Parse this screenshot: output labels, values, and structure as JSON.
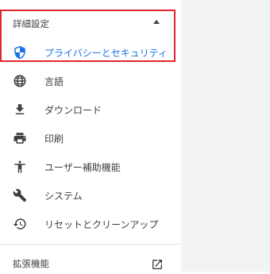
{
  "advanced": {
    "label": "詳細設定",
    "expanded": true
  },
  "menu": {
    "items": [
      {
        "label": "プライバシーとセキュリティ",
        "icon": "shield-icon",
        "active": true
      },
      {
        "label": "言語",
        "icon": "globe-icon"
      },
      {
        "label": "ダウンロード",
        "icon": "download-icon"
      },
      {
        "label": "印刷",
        "icon": "printer-icon"
      },
      {
        "label": "ユーザー補助機能",
        "icon": "accessibility-icon"
      },
      {
        "label": "システム",
        "icon": "wrench-icon"
      },
      {
        "label": "リセットとクリーンアップ",
        "icon": "restore-icon"
      }
    ]
  },
  "extensions": {
    "label": "拡張機能",
    "icon": "open-in-new-icon"
  },
  "colors": {
    "accent": "#1a73e8",
    "text": "#3c4043",
    "highlight_border": "#e0262f",
    "background_right": "#f1f3f4"
  }
}
